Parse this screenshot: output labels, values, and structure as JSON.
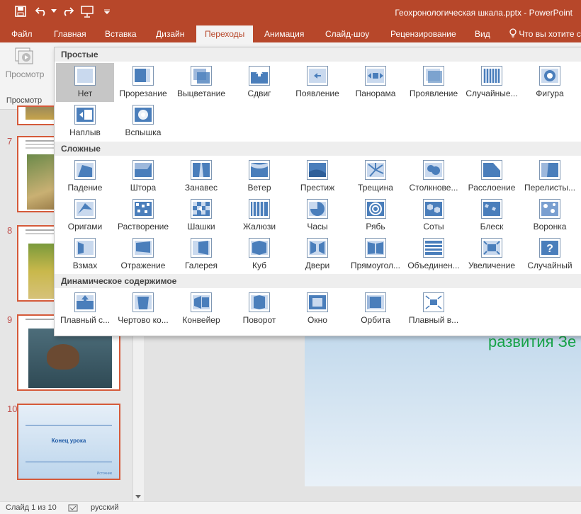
{
  "window": {
    "title": "Геохронологическая шкала.pptx - PowerPoint"
  },
  "qat": {
    "icons": [
      "save-icon",
      "undo-icon",
      "redo-icon",
      "present-icon",
      "customize-icon"
    ]
  },
  "ribbon": {
    "tabs": [
      {
        "label": "Файл",
        "active": false
      },
      {
        "label": "Главная",
        "active": false
      },
      {
        "label": "Вставка",
        "active": false
      },
      {
        "label": "Дизайн",
        "active": false
      },
      {
        "label": "Переходы",
        "active": true
      },
      {
        "label": "Анимация",
        "active": false
      },
      {
        "label": "Слайд-шоу",
        "active": false
      },
      {
        "label": "Рецензирование",
        "active": false
      },
      {
        "label": "Вид",
        "active": false
      }
    ],
    "tell_me": "Что вы хотите с",
    "preview_button": "Просмотр",
    "preview_group": "Просмотр"
  },
  "gallery": {
    "sections": [
      {
        "title": "Простые",
        "items": [
          {
            "label": "Нет",
            "selected": true
          },
          {
            "label": "Прорезание"
          },
          {
            "label": "Выцветание"
          },
          {
            "label": "Сдвиг"
          },
          {
            "label": "Появление"
          },
          {
            "label": "Панорама"
          },
          {
            "label": "Проявление"
          },
          {
            "label": "Случайные..."
          },
          {
            "label": "Фигура"
          },
          {
            "label": "Наплыв"
          },
          {
            "label": "Вспышка"
          }
        ]
      },
      {
        "title": "Сложные",
        "items": [
          {
            "label": "Падение"
          },
          {
            "label": "Штора"
          },
          {
            "label": "Занавес"
          },
          {
            "label": "Ветер"
          },
          {
            "label": "Престиж"
          },
          {
            "label": "Трещина"
          },
          {
            "label": "Столкнове..."
          },
          {
            "label": "Расслоение"
          },
          {
            "label": "Перелисты..."
          },
          {
            "label": "Оригами"
          },
          {
            "label": "Растворение"
          },
          {
            "label": "Шашки"
          },
          {
            "label": "Жалюзи"
          },
          {
            "label": "Часы"
          },
          {
            "label": "Рябь"
          },
          {
            "label": "Соты"
          },
          {
            "label": "Блеск"
          },
          {
            "label": "Воронка"
          },
          {
            "label": "Взмах"
          },
          {
            "label": "Отражение"
          },
          {
            "label": "Галерея"
          },
          {
            "label": "Куб"
          },
          {
            "label": "Двери"
          },
          {
            "label": "Прямоугол..."
          },
          {
            "label": "Объединен..."
          },
          {
            "label": "Увеличение"
          },
          {
            "label": "Случайный"
          }
        ]
      },
      {
        "title": "Динамическое содержимое",
        "items": [
          {
            "label": "Плавный с..."
          },
          {
            "label": "Чертово ко..."
          },
          {
            "label": "Конвейер"
          },
          {
            "label": "Поворот"
          },
          {
            "label": "Окно"
          },
          {
            "label": "Орбита"
          },
          {
            "label": "Плавный в..."
          }
        ]
      }
    ]
  },
  "slides": [
    {
      "number": "7"
    },
    {
      "number": "8"
    },
    {
      "number": "9"
    },
    {
      "number": "10",
      "title": "Конец урока",
      "footer": "Источник"
    }
  ],
  "slide_text": "развития Зе",
  "status": {
    "slide": "Слайд 1 из 10",
    "language": "русский"
  },
  "colors": {
    "accent": "#b7472a",
    "icon_blue": "#4a7ebb",
    "slide_text": "#17a449",
    "selection": "#c6c6c6"
  }
}
